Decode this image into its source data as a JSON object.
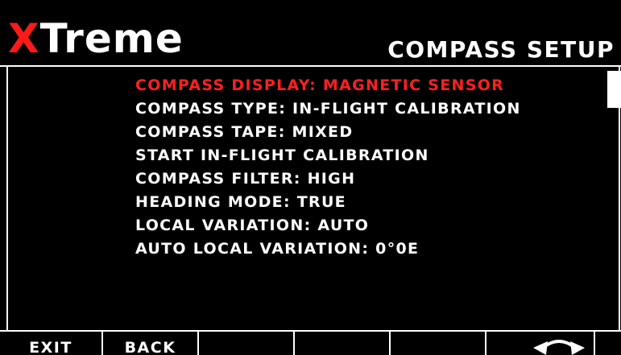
{
  "header": {
    "logo_x": "X",
    "logo_rest": "Treme",
    "title": "COMPASS SETUP"
  },
  "menu": {
    "items": [
      {
        "label": "COMPASS DISPLAY: MAGNETIC SENSOR",
        "selected": true
      },
      {
        "label": "COMPASS TYPE: IN-FLIGHT CALIBRATION",
        "selected": false
      },
      {
        "label": "COMPASS TAPE: MIXED",
        "selected": false
      },
      {
        "label": "START IN-FLIGHT CALIBRATION",
        "selected": false
      },
      {
        "label": "COMPASS FILTER: HIGH",
        "selected": false
      },
      {
        "label": "HEADING MODE: TRUE",
        "selected": false
      },
      {
        "label": "LOCAL VARIATION: AUTO",
        "selected": false
      },
      {
        "label": "AUTO LOCAL VARIATION: 0°0E",
        "selected": false
      }
    ]
  },
  "softkeys": [
    {
      "label": "EXIT"
    },
    {
      "label": "BACK"
    },
    {
      "label": ""
    },
    {
      "label": ""
    },
    {
      "label": ""
    },
    {
      "label": "",
      "icon": "rotate-knob-icon"
    }
  ],
  "colors": {
    "background": "#000000",
    "text": "#ffffff",
    "accent_red": "#ff2020"
  }
}
